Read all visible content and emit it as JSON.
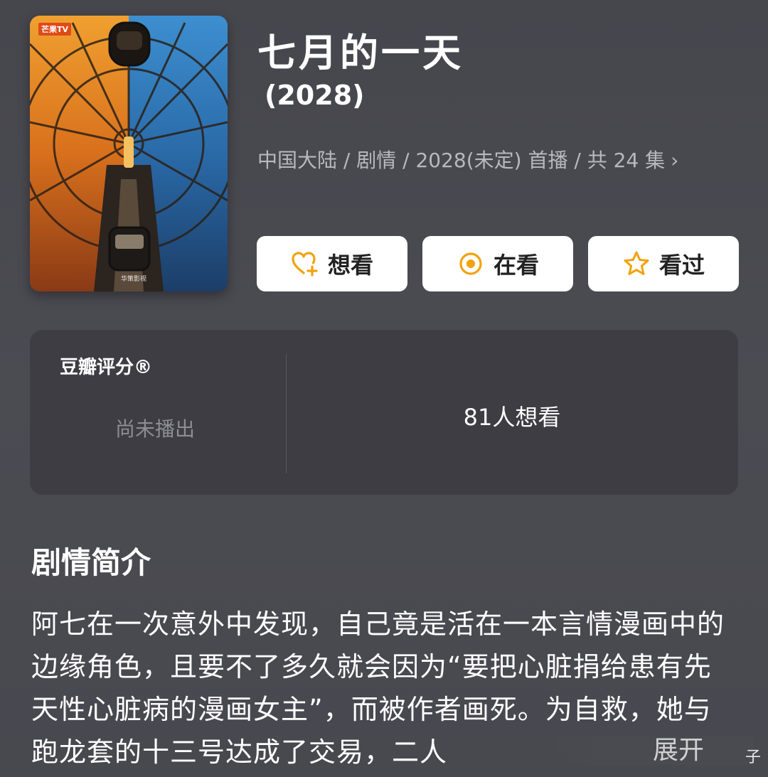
{
  "poster": {
    "channel_logo": "芒果TV",
    "studio_mark": "华策影视"
  },
  "show": {
    "title": "七月的一天",
    "year": "(2028)",
    "meta": "中国大陆 / 剧情 / 2028(未定) 首播 / 共 24 集",
    "meta_chevron": "›"
  },
  "actions": {
    "want": {
      "label": "想看",
      "icon": "heart-plus-icon"
    },
    "watching": {
      "label": "在看",
      "icon": "target-circle-icon"
    },
    "watched": {
      "label": "看过",
      "icon": "star-icon"
    }
  },
  "rating": {
    "label": "豆瓣评分®",
    "status": "尚未播出",
    "want_count": "81人想看"
  },
  "synopsis": {
    "heading": "剧情简介",
    "text": "阿七在一次意外中发现，自己竟是活在一本言情漫画中的边缘角色，且要不了多久就会因为“要把心脏捐给患有先天性心脏病的漫画女主”，而被作者画死。为自救，她与跑龙套的十三号达成了交易，二人",
    "expand_label": "展开"
  },
  "corner_mark": "子",
  "colors": {
    "background": "#4a4a51",
    "card": "#3d3d43",
    "accent_orange": "#f2a20c",
    "meta_text": "#b8b8be"
  }
}
